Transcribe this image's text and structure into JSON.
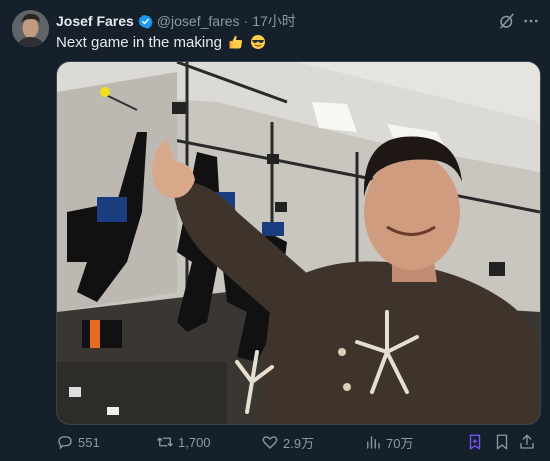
{
  "post": {
    "author_name": "Josef Fares",
    "handle": "@josef_fares",
    "separator": "·",
    "time": "17小时",
    "text": "Next game in the making"
  },
  "icons": {
    "verified": "verified-badge-icon",
    "grok": "grok-icon",
    "more": "more-icon",
    "emoji1": "thumbs-up-emoji",
    "emoji2": "sunglasses-emoji",
    "reply": "reply-icon",
    "retweet": "retweet-icon",
    "like": "heart-icon",
    "views": "views-icon",
    "grok_action": "grok-action-icon",
    "bookmark": "bookmark-icon",
    "share": "share-icon"
  },
  "stats": {
    "replies": "551",
    "retweets": "1,700",
    "likes": "2.9万",
    "views": "70万"
  },
  "colors": {
    "background": "#15202b",
    "text": "#e7e9ea",
    "muted": "#8b98a5",
    "accent": "#1d9bf0",
    "grok_accent": "#7856ff"
  }
}
